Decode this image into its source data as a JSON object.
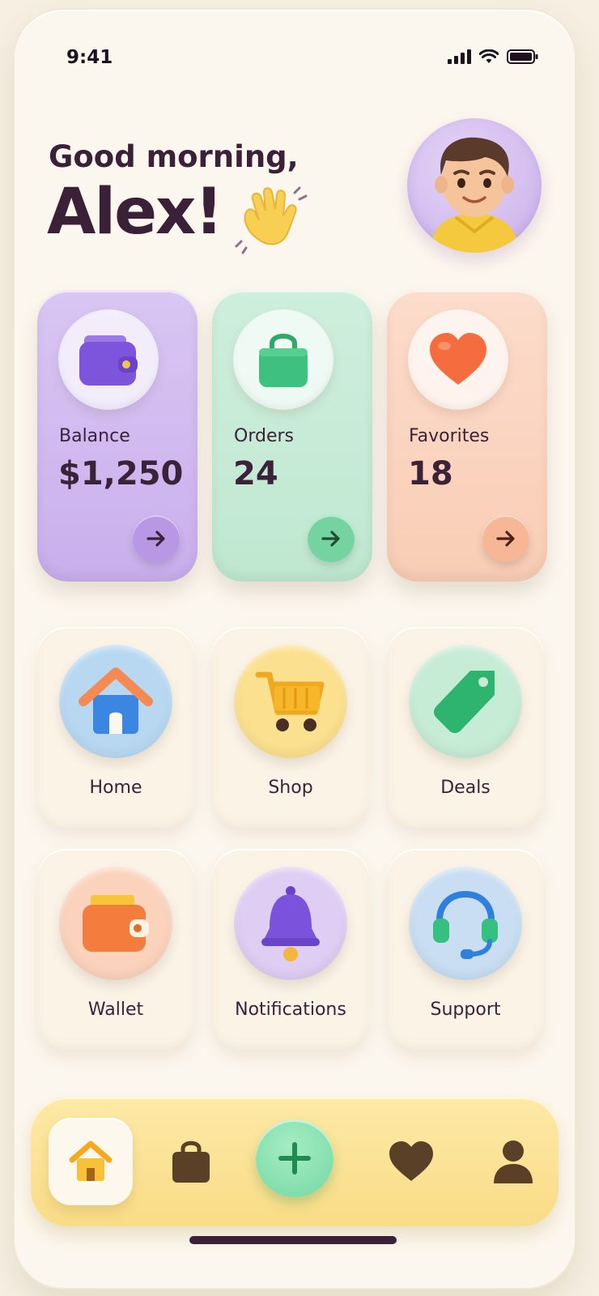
{
  "status_bar": {
    "time": "9:41"
  },
  "header": {
    "greeting": "Good morning,",
    "name": "Alex!"
  },
  "stats": [
    {
      "label": "Balance",
      "value": "$1,250",
      "icon": "wallet-icon",
      "color": "#c9afec"
    },
    {
      "label": "Orders",
      "value": "24",
      "icon": "shopping-bag-icon",
      "color": "#bfe8d0"
    },
    {
      "label": "Favorites",
      "value": "18",
      "icon": "heart-icon",
      "color": "#f9cdb5"
    }
  ],
  "tiles": [
    {
      "label": "Home",
      "icon": "house-icon",
      "color": "#b8d8f2"
    },
    {
      "label": "Shop",
      "icon": "cart-icon",
      "color": "#fbe08f"
    },
    {
      "label": "Deals",
      "icon": "tag-icon",
      "color": "#c7ecd6"
    },
    {
      "label": "Wallet",
      "icon": "wallet-icon",
      "color": "#fbd3bd"
    },
    {
      "label": "Notifications",
      "icon": "bell-icon",
      "color": "#dfcdf3"
    },
    {
      "label": "Support",
      "icon": "headset-icon",
      "color": "#c9def2"
    }
  ],
  "nav": {
    "items": [
      "home-icon",
      "bag-icon",
      "add-icon",
      "heart-icon",
      "profile-icon"
    ],
    "active": "home-icon",
    "accent": "#f9dc86"
  }
}
